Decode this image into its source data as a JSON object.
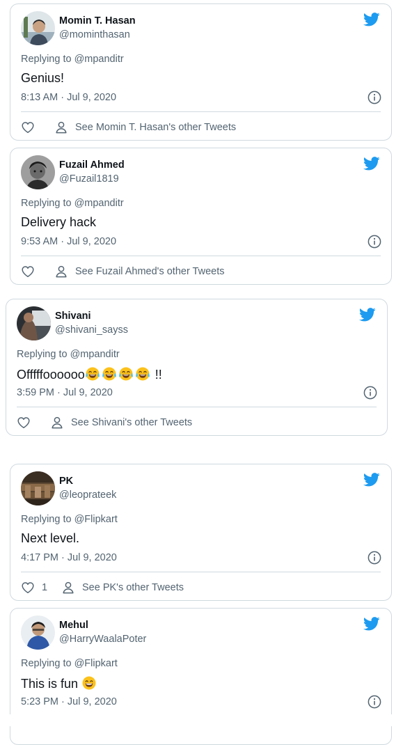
{
  "tweets": [
    {
      "name": "Momin T. Hasan",
      "handle": "@mominthasan",
      "replying_to": "Replying to @mpanditr",
      "text": "Genius!",
      "emoji_count": 0,
      "suffix": "",
      "time": "8:13 AM · Jul 9, 2020",
      "likes": "",
      "see_other": "See Momin T. Hasan's other Tweets"
    },
    {
      "name": "Fuzail Ahmed",
      "handle": "@Fuzail1819",
      "replying_to": "Replying to @mpanditr",
      "text": "Delivery hack",
      "emoji_count": 0,
      "suffix": "",
      "time": "9:53 AM · Jul 9, 2020",
      "likes": "",
      "see_other": "See Fuzail Ahmed's other Tweets"
    },
    {
      "name": "Shivani",
      "handle": "@shivani_sayss",
      "replying_to": "Replying to @mpanditr",
      "text": "Offfffoooooo",
      "emoji_count": 4,
      "suffix": " !!",
      "time": "3:59 PM · Jul 9, 2020",
      "likes": "",
      "see_other": "See Shivani's other Tweets"
    },
    {
      "name": "PK",
      "handle": "@leoprateek",
      "replying_to": "Replying to @Flipkart",
      "text": "Next level.",
      "emoji_count": 0,
      "suffix": "",
      "time": "4:17 PM · Jul 9, 2020",
      "likes": "1",
      "see_other": "See PK's other Tweets"
    },
    {
      "name": "Mehul",
      "handle": "@HarryWaalaPoter",
      "replying_to": "Replying to @Flipkart",
      "text": "This is fun ",
      "emoji_count": 0,
      "suffix": "",
      "time": "5:23 PM · Jul 9, 2020",
      "likes": "",
      "see_other": ""
    }
  ],
  "icons": {
    "brand": "twitter-bird-icon",
    "info": "info-circle-icon",
    "like": "heart-outline-icon",
    "profile": "person-outline-icon",
    "laugh": "tears-of-joy-emoji",
    "grin": "grinning-emoji"
  },
  "colors": {
    "twitter_blue": "#1d9bf0",
    "muted_text": "#536471",
    "border": "#cfd9de"
  }
}
